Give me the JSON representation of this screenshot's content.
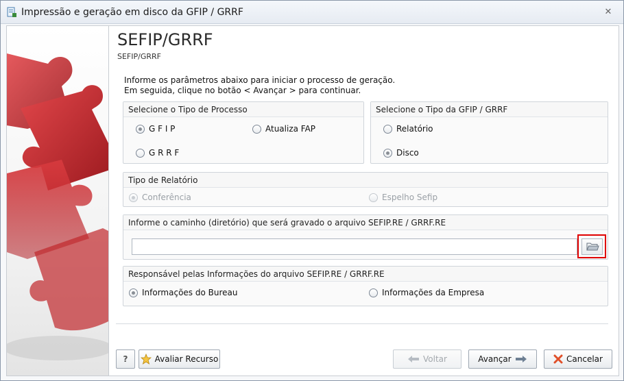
{
  "window": {
    "title": "Impressão e geração em disco da GFIP / GRRF"
  },
  "header": {
    "title": "SEFIP/GRRF",
    "subtitle": "SEFIP/GRRF"
  },
  "intro": {
    "line1": "Informe os parâmetros abaixo para iniciar o processo de geração.",
    "line2": "Em seguida, clique no botão < Avançar > para continuar."
  },
  "process_type": {
    "title": "Selecione o Tipo de Processo",
    "options": [
      {
        "label": "G F I P",
        "selected": true
      },
      {
        "label": "Atualiza FAP",
        "selected": false
      },
      {
        "label": "G R R F",
        "selected": false
      }
    ]
  },
  "gfip_type": {
    "title": "Selecione o Tipo da GFIP / GRRF",
    "options": [
      {
        "label": "Relatório",
        "selected": false
      },
      {
        "label": "Disco",
        "selected": true
      }
    ]
  },
  "report_type": {
    "title": "Tipo de Relatório",
    "options": [
      {
        "label": "Conferência",
        "selected": true,
        "enabled": false
      },
      {
        "label": "Espelho Sefip",
        "selected": false,
        "enabled": false
      }
    ]
  },
  "path": {
    "title": "Informe o caminho (diretório) que será gravado o arquivo SEFIP.RE / GRRF.RE",
    "value": "",
    "browse_icon": "folder-icon"
  },
  "responsible": {
    "title": "Responsável pelas Informações do arquivo SEFIP.RE / GRRF.RE",
    "options": [
      {
        "label": "Informações do Bureau",
        "selected": true
      },
      {
        "label": "Informações da Empresa",
        "selected": false
      }
    ]
  },
  "footer": {
    "help_label": "?",
    "evaluate_label": "Avaliar Recurso",
    "back_label": "Voltar",
    "next_label": "Avançar",
    "cancel_label": "Cancelar"
  },
  "colors": {
    "highlight": "#e00000",
    "puzzle": "#c0262b"
  }
}
